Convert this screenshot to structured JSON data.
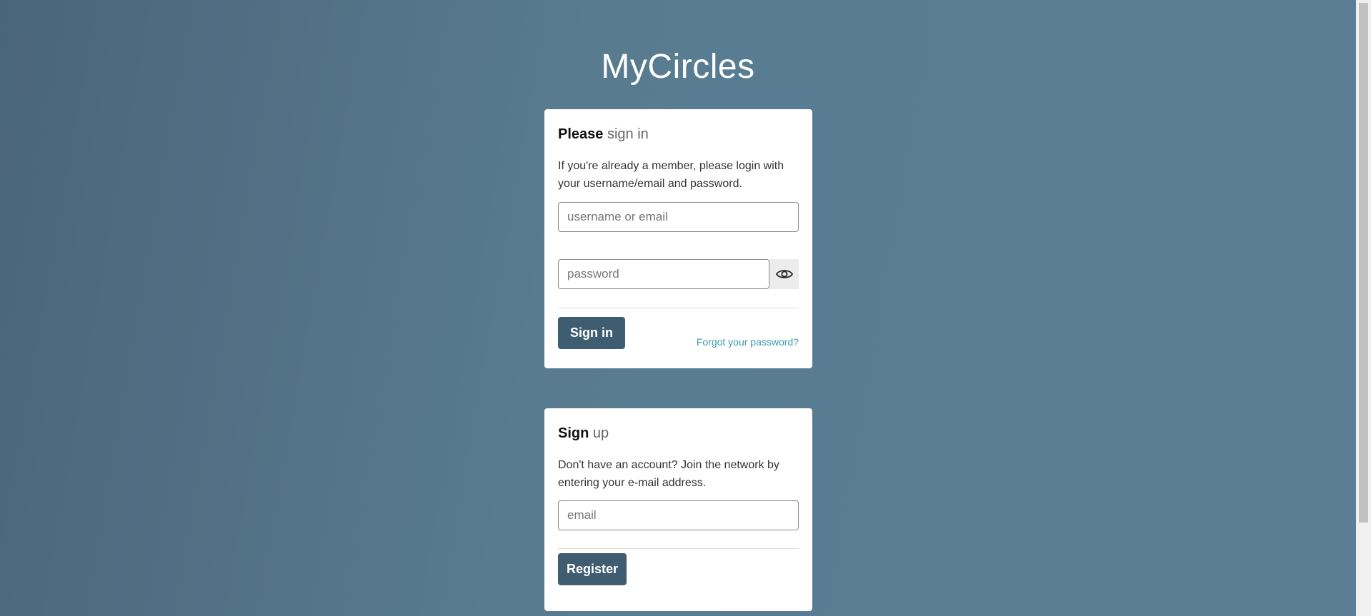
{
  "app": {
    "title": "MyCircles"
  },
  "signin": {
    "title_bold": "Please",
    "title_light": "sign in",
    "description": "If you're already a member, please login with your username/email and password.",
    "username_placeholder": "username or email",
    "password_placeholder": "password",
    "toggle_icon": "eye-icon",
    "submit_label": "Sign in",
    "forgot_link": "Forgot your password?"
  },
  "signup": {
    "title_bold": "Sign",
    "title_light": "up",
    "description": "Don't have an account? Join the network by entering your e-mail address.",
    "email_placeholder": "email",
    "submit_label": "Register"
  },
  "colors": {
    "background_left": "#4a6579",
    "background_right": "#5a7f95",
    "button": "#3f5d70",
    "link": "#3a9bb0"
  }
}
